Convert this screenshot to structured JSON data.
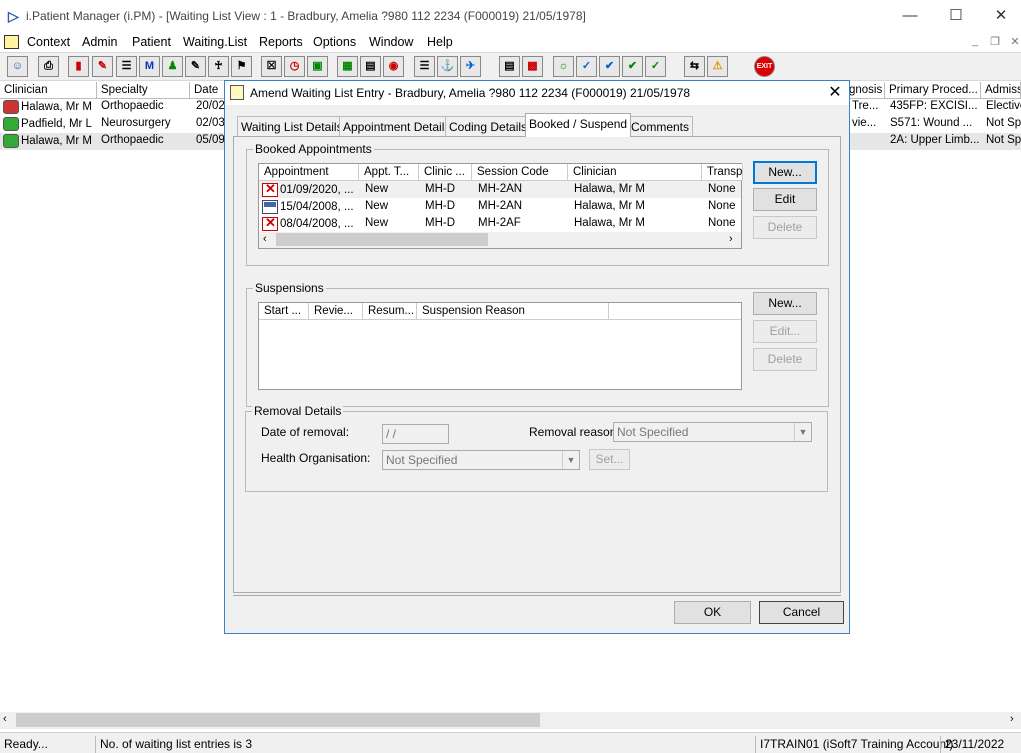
{
  "app": {
    "title": "i.Patient Manager (i.PM) - [Waiting List View :  1 - Bradbury, Amelia ?980 112 2234 (F000019) 21/05/1978]",
    "menu": [
      "Context",
      "Admin",
      "Patient",
      "Waiting.List",
      "Reports",
      "Options",
      "Window",
      "Help"
    ]
  },
  "grid": {
    "columns_left": [
      "Clinician",
      "Specialty",
      "Date"
    ],
    "columns_right": [
      "gnosis",
      "Primary Proced...",
      "Admissi"
    ],
    "rows": [
      {
        "clinician": "Halawa, Mr M",
        "specialty": "Orthopaedic",
        "date": "20/02",
        "diag": "Tre...",
        "proc": "435FP: EXCISI...",
        "adm": "Elective"
      },
      {
        "clinician": "Padfield, Mr L",
        "specialty": "Neurosurgery",
        "date": "02/03",
        "diag": "vie...",
        "proc": "S571: Wound ...",
        "adm": "Not Spe"
      },
      {
        "clinician": "Halawa, Mr M",
        "specialty": "Orthopaedic",
        "date": "05/09",
        "diag": "",
        "proc": "2A: Upper Limb...",
        "adm": "Not Spe"
      }
    ]
  },
  "status": {
    "ready": "Ready...",
    "entries": "No. of waiting list entries is 3",
    "user": "I7TRAIN01 (iSoft7 Training Account)",
    "date": "23/11/2022"
  },
  "dialog": {
    "title": "Amend Waiting List Entry - Bradbury, Amelia ?980 112 2234 (F000019) 21/05/1978",
    "tabs": [
      "Waiting List Details",
      "Appointment Details",
      "Coding Details",
      "Booked / Suspend",
      "Comments"
    ],
    "booked": {
      "label": "Booked Appointments",
      "columns": [
        "Appointment",
        "Appt. T...",
        "Clinic ...",
        "Session Code",
        "Clinician",
        "Transp"
      ],
      "rows": [
        {
          "appt": "01/09/2020, ...",
          "type": "New",
          "clinic": "MH-D",
          "session": "MH-2AN",
          "clinician": "Halawa, Mr M",
          "transp": "None"
        },
        {
          "appt": "15/04/2008, ...",
          "type": "New",
          "clinic": "MH-D",
          "session": "MH-2AN",
          "clinician": "Halawa, Mr M",
          "transp": "None"
        },
        {
          "appt": "08/04/2008, ...",
          "type": "New",
          "clinic": "MH-D",
          "session": "MH-2AF",
          "clinician": "Halawa, Mr M",
          "transp": "None"
        }
      ],
      "buttons": {
        "new": "New...",
        "edit": "Edit",
        "delete": "Delete"
      }
    },
    "suspensions": {
      "label": "Suspensions",
      "columns": [
        "Start ...",
        "Revie...",
        "Resum...",
        "Suspension Reason"
      ],
      "buttons": {
        "new": "New...",
        "edit": "Edit...",
        "delete": "Delete"
      }
    },
    "removal": {
      "label": "Removal Details",
      "date_label": "Date of removal:",
      "date_value": " /  /",
      "reason_label": "Removal reason:",
      "reason_value": "Not Specified",
      "org_label": "Health Organisation:",
      "org_value": "Not Specified",
      "set_button": "Set..."
    },
    "ok": "OK",
    "cancel": "Cancel"
  }
}
